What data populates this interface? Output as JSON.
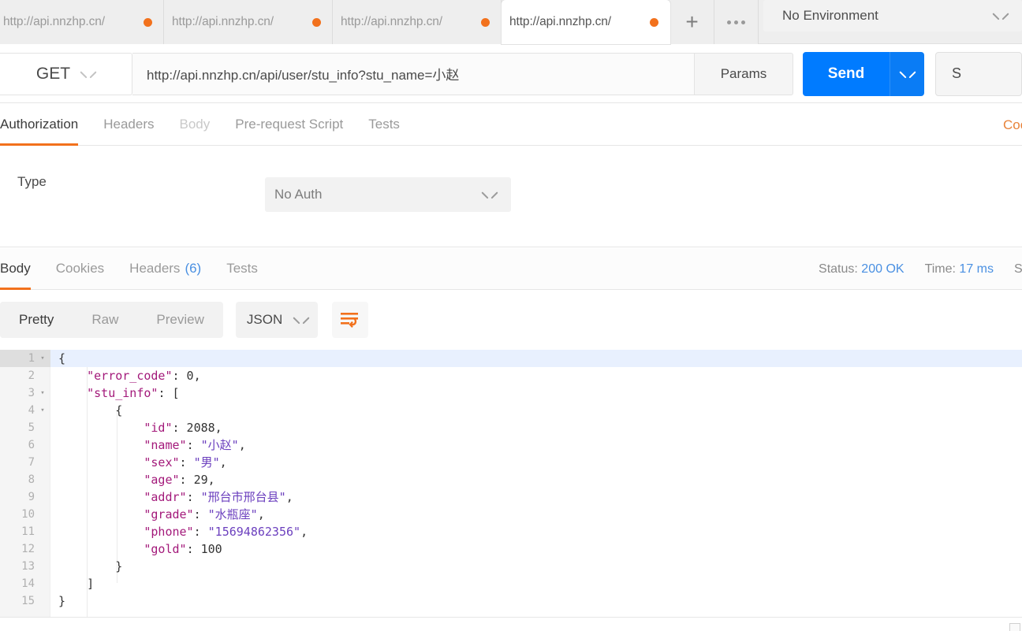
{
  "tabbar": {
    "tabs": [
      {
        "label": "http://api.nnzhp.cn/",
        "active": false
      },
      {
        "label": "http://api.nnzhp.cn/",
        "active": false
      },
      {
        "label": "http://api.nnzhp.cn/",
        "active": false
      },
      {
        "label": "http://api.nnzhp.cn/",
        "active": true
      }
    ],
    "new_tab_label": "+",
    "more_label": "...",
    "environment": "No Environment"
  },
  "request": {
    "method": "GET",
    "url": "http://api.nnzhp.cn/api/user/stu_info?stu_name=小赵",
    "params_label": "Params",
    "send_label": "Send",
    "save_label": "S"
  },
  "request_tabs": {
    "items": [
      {
        "label": "Authorization",
        "state": "active"
      },
      {
        "label": "Headers",
        "state": "normal"
      },
      {
        "label": "Body",
        "state": "disabled"
      },
      {
        "label": "Pre-request Script",
        "state": "normal"
      },
      {
        "label": "Tests",
        "state": "normal"
      }
    ],
    "cookies_link": "Cookies"
  },
  "auth": {
    "type_label": "Type",
    "type_value": "No Auth"
  },
  "response_tabs": {
    "items": [
      {
        "label": "Body",
        "state": "active",
        "count": ""
      },
      {
        "label": "Cookies",
        "state": "normal",
        "count": ""
      },
      {
        "label": "Headers",
        "state": "normal",
        "count": "(6)"
      },
      {
        "label": "Tests",
        "state": "normal",
        "count": ""
      }
    ],
    "status_label": "Status:",
    "status_value": "200 OK",
    "time_label": "Time:",
    "time_value": "17 ms",
    "size_label": "S"
  },
  "body_toolbar": {
    "views": [
      {
        "label": "Pretty",
        "active": true
      },
      {
        "label": "Raw",
        "active": false
      },
      {
        "label": "Preview",
        "active": false
      }
    ],
    "format": "JSON",
    "wrap_icon": "word-wrap-icon"
  },
  "code": {
    "lines": [
      {
        "num": "1",
        "fold": "▾",
        "highlight": true,
        "text": "{"
      },
      {
        "num": "2",
        "fold": "",
        "highlight": false,
        "text": "    \"error_code\": 0,"
      },
      {
        "num": "3",
        "fold": "▾",
        "highlight": false,
        "text": "    \"stu_info\": ["
      },
      {
        "num": "4",
        "fold": "▾",
        "highlight": false,
        "text": "        {"
      },
      {
        "num": "5",
        "fold": "",
        "highlight": false,
        "text": "            \"id\": 2088,"
      },
      {
        "num": "6",
        "fold": "",
        "highlight": false,
        "text": "            \"name\": \"小赵\","
      },
      {
        "num": "7",
        "fold": "",
        "highlight": false,
        "text": "            \"sex\": \"男\","
      },
      {
        "num": "8",
        "fold": "",
        "highlight": false,
        "text": "            \"age\": 29,"
      },
      {
        "num": "9",
        "fold": "",
        "highlight": false,
        "text": "            \"addr\": \"邢台市邢台县\","
      },
      {
        "num": "10",
        "fold": "",
        "highlight": false,
        "text": "            \"grade\": \"水瓶座\","
      },
      {
        "num": "11",
        "fold": "",
        "highlight": false,
        "text": "            \"phone\": \"15694862356\","
      },
      {
        "num": "12",
        "fold": "",
        "highlight": false,
        "text": "            \"gold\": 100"
      },
      {
        "num": "13",
        "fold": "",
        "highlight": false,
        "text": "        }"
      },
      {
        "num": "14",
        "fold": "",
        "highlight": false,
        "text": "    ]"
      },
      {
        "num": "15",
        "fold": "",
        "highlight": false,
        "text": "}"
      }
    ],
    "json": {
      "error_code": 0,
      "stu_info": [
        {
          "id": 2088,
          "name": "小赵",
          "sex": "男",
          "age": 29,
          "addr": "邢台市邢台县",
          "grade": "水瓶座",
          "phone": "15694862356",
          "gold": 100
        }
      ]
    }
  },
  "colors": {
    "accent_orange": "#f2711c",
    "send_blue": "#007bff",
    "link_blue": "#4a90e2",
    "key_purple": "#a3197a",
    "string_purple": "#6b3fbe",
    "number_blue": "#2e52c9"
  }
}
